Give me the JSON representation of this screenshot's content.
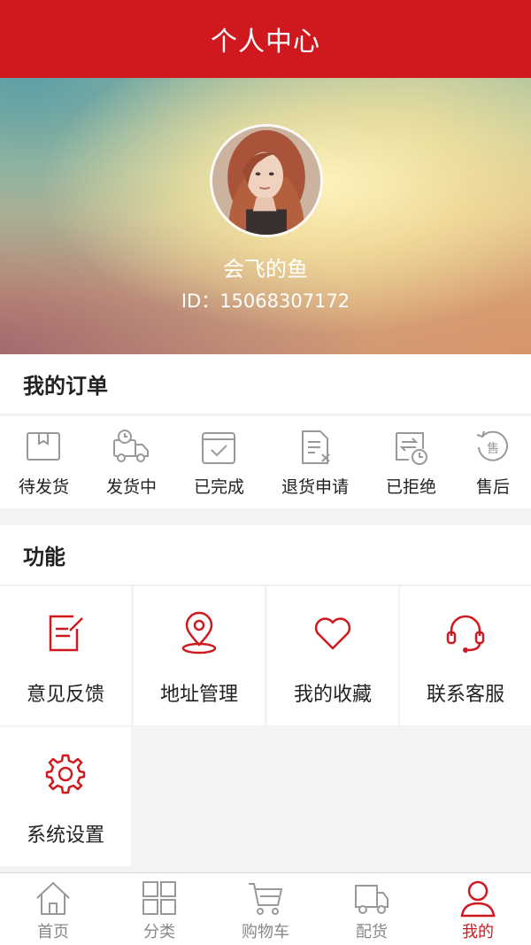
{
  "header": {
    "title": "个人中心"
  },
  "profile": {
    "nickname": "会飞的鱼",
    "user_id": "ID：15068307172"
  },
  "orders_section": {
    "title": "我的订单",
    "items": [
      {
        "label": "待发货",
        "icon": "pending-shipment-icon"
      },
      {
        "label": "发货中",
        "icon": "shipping-truck-icon"
      },
      {
        "label": "已完成",
        "icon": "completed-check-icon"
      },
      {
        "label": "退货申请",
        "icon": "return-request-icon"
      },
      {
        "label": "已拒绝",
        "icon": "rejected-icon"
      },
      {
        "label": "售后",
        "icon": "after-sales-icon"
      }
    ],
    "after_sales_badge": "售"
  },
  "features_section": {
    "title": "功能",
    "items": [
      {
        "label": "意见反馈",
        "icon": "feedback-edit-icon"
      },
      {
        "label": "地址管理",
        "icon": "location-pin-icon"
      },
      {
        "label": "我的收藏",
        "icon": "heart-icon"
      },
      {
        "label": "联系客服",
        "icon": "headset-icon"
      },
      {
        "label": "系统设置",
        "icon": "gear-icon"
      }
    ]
  },
  "tabbar": {
    "items": [
      {
        "label": "首页",
        "icon": "home-icon"
      },
      {
        "label": "分类",
        "icon": "grid-icon"
      },
      {
        "label": "购物车",
        "icon": "cart-icon"
      },
      {
        "label": "配货",
        "icon": "delivery-truck-icon"
      },
      {
        "label": "我的",
        "icon": "user-icon",
        "active": true
      }
    ]
  },
  "colors": {
    "primary": "#d0191f",
    "icon_gray": "#999999",
    "text": "#222222"
  }
}
